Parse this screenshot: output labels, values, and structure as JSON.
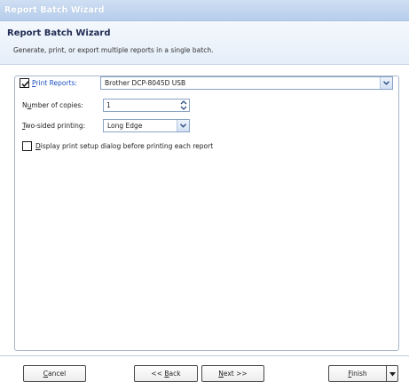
{
  "window": {
    "title": "Report Batch Wizard"
  },
  "header": {
    "title": "Report Batch Wizard",
    "subtitle": "Generate, print, or export multiple reports in a single batch."
  },
  "print_reports": {
    "checked": true,
    "label_prefix": "",
    "label_mnemonic": "P",
    "label_rest": "rint Reports:",
    "printer_value": "Brother DCP-8045D USB"
  },
  "copies": {
    "label_pre": "N",
    "label_mnemonic": "u",
    "label_rest": "mber of copies:",
    "value": "1"
  },
  "two_sided": {
    "label_mnemonic": "T",
    "label_rest": "wo-sided printing:",
    "value": "Long Edge"
  },
  "display_setup": {
    "checked": false,
    "label_mnemonic": "D",
    "label_rest": "isplay print setup dialog before printing each report"
  },
  "buttons": {
    "cancel": {
      "mnemonic": "C",
      "rest": "ancel"
    },
    "back": {
      "pre": "<< ",
      "mnemonic": "B",
      "rest": "ack"
    },
    "next": {
      "mnemonic": "N",
      "rest": "ext >>"
    },
    "finish": {
      "mnemonic": "F",
      "rest": "inish"
    }
  },
  "icons": {
    "checkmark": "checkmark-icon",
    "dropdown": "chevron-down-icon",
    "spin_up": "spin-up-icon",
    "spin_down": "spin-down-icon"
  },
  "colors": {
    "titlebar": "#b6cdeb",
    "header_bg": "#e5eef9",
    "link_label": "#1e4fbf",
    "header_title": "#1f2b52",
    "border": "#a7b6c9"
  }
}
